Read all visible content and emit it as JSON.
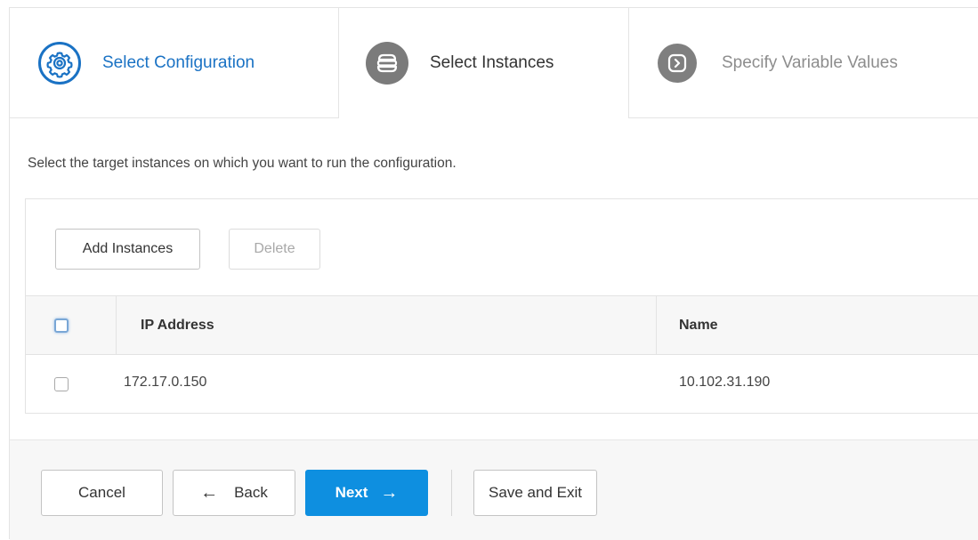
{
  "wizard": {
    "steps": [
      {
        "label": "Select Configuration",
        "icon": "gear-icon",
        "state": "completed"
      },
      {
        "label": "Select Instances",
        "icon": "server-icon",
        "state": "active"
      },
      {
        "label": "Specify Variable Values",
        "icon": "chevron-right-icon",
        "state": "pending"
      }
    ]
  },
  "intro_text": "Select the target instances on which you want to run the configuration.",
  "toolbar": {
    "add_label": "Add Instances",
    "delete_label": "Delete"
  },
  "table": {
    "columns": [
      "IP Address",
      "Name"
    ],
    "rows": [
      {
        "ip": "172.17.0.150",
        "name": "10.102.31.190"
      }
    ]
  },
  "footer": {
    "cancel_label": "Cancel",
    "back_label": "Back",
    "next_label": "Next",
    "save_label": "Save and Exit"
  },
  "colors": {
    "accent": "#1a72c4",
    "primary_button": "#0e8fe0"
  }
}
